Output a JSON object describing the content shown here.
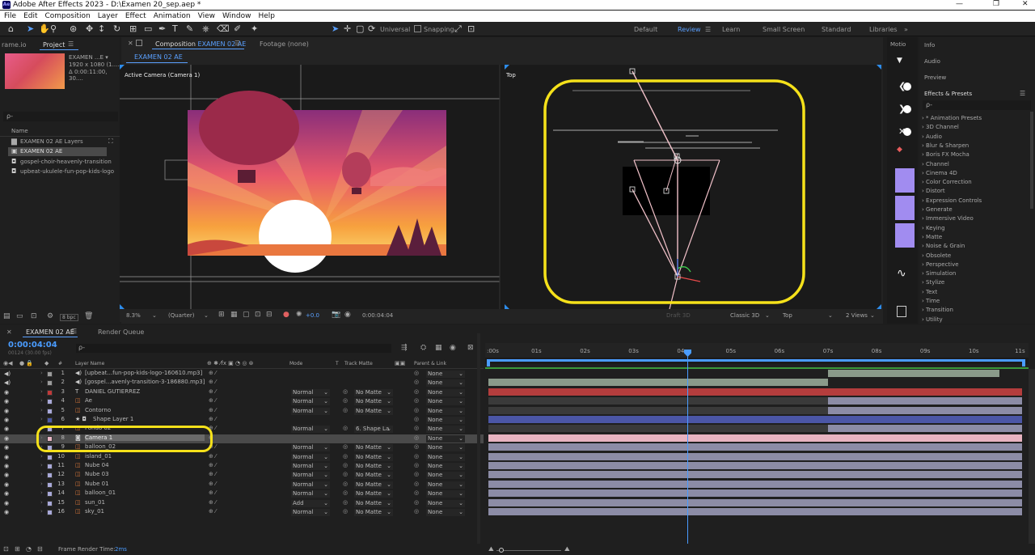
{
  "app": {
    "title": "Adobe After Effects 2023 - D:\\Examen 20_sep.aep *",
    "logo": "Ae"
  },
  "menu": [
    "File",
    "Edit",
    "Composition",
    "Layer",
    "Effect",
    "Animation",
    "View",
    "Window",
    "Help"
  ],
  "toolbar": {
    "universal": "Universal",
    "snapping": "Snapping"
  },
  "workspaces": [
    {
      "label": "Default",
      "active": false
    },
    {
      "label": "Review",
      "active": true
    },
    {
      "label": "Learn",
      "active": false
    },
    {
      "label": "Small Screen",
      "active": false
    },
    {
      "label": "Standard",
      "active": false
    },
    {
      "label": "Libraries",
      "active": false
    }
  ],
  "project": {
    "tab_left": "rame.io",
    "tab": "Project",
    "item_name": "EXAMEN ...E ▾",
    "item_dims": "1920 x 1080 (1....",
    "item_dur": "Δ 0:00:11:00, 30....",
    "search_placeholder": "ρ-",
    "col_name": "Name",
    "items": [
      {
        "label": "EXAMEN 02 AE Layers",
        "icon": "folder-icon",
        "selected": false
      },
      {
        "label": "EXAMEN 02 AE",
        "icon": "composition-icon",
        "selected": true
      },
      {
        "label": "gospel-choir-heavenly-transition",
        "icon": "audio-file-icon",
        "selected": false
      },
      {
        "label": "upbeat-ukulele-fun-pop-kids-logo",
        "icon": "audio-file-icon",
        "selected": false
      }
    ],
    "bpc": "8 bpc"
  },
  "composition": {
    "tab_label": "Composition",
    "tab_name": "EXAMEN 02 AE",
    "footage": "Footage (none)",
    "subtab": "EXAMEN 02 AE",
    "left_view": "Active Camera (Camera 1)",
    "right_view": "Top",
    "zoom": "8.3%",
    "resolution": "(Quarter)",
    "exposure": "+0.0",
    "timecode": "0:00:04:04",
    "draft": "Draft 3D",
    "renderer": "Classic 3D",
    "view_select": "Top",
    "views": "2 Views"
  },
  "right_panel": {
    "tab_motion": "Motio",
    "info": "Info",
    "audio": "Audio",
    "preview": "Preview",
    "effects_title": "Effects & Presets",
    "effects_search": "ρ-",
    "effects": [
      "* Animation Presets",
      "3D Channel",
      "Audio",
      "Blur & Sharpen",
      "Boris FX Mocha",
      "Channel",
      "Cinema 4D",
      "Color Correction",
      "Distort",
      "Expression Controls",
      "Generate",
      "Immersive Video",
      "Keying",
      "Matte",
      "Noise & Grain",
      "Obsolete",
      "Perspective",
      "Simulation",
      "Stylize",
      "Text",
      "Time",
      "Transition",
      "Utility"
    ]
  },
  "timeline": {
    "tab": "EXAMEN 02 AE",
    "render_queue": "Render Queue",
    "timecode": "0:00:04:04",
    "frame_info": "00124 (30.00 fps)",
    "col_hash": "#",
    "col_layer": "Layer Name",
    "col_mode": "Mode",
    "col_t": "T",
    "col_track": "Track Matte",
    "col_parent": "Parent & Link",
    "ruler": [
      ":00s",
      "01s",
      "02s",
      "03s",
      "04s",
      "05s",
      "06s",
      "07s",
      "08s",
      "09s",
      "10s",
      "11s"
    ],
    "render_time_label": "Frame Render Time:",
    "render_time_value": "2ms",
    "layers": [
      {
        "num": "1",
        "name": "[upbeat...fun-pop-kids-logo-160610.mp3]",
        "type": "audio",
        "color": "#9c9c9c",
        "mode": "",
        "track": "",
        "parent": "None",
        "audio": true
      },
      {
        "num": "2",
        "name": "[gospel...avenly-transition-3-186880.mp3]",
        "type": "audio",
        "color": "#9c9c9c",
        "mode": "",
        "track": "",
        "parent": "None",
        "audio": true
      },
      {
        "num": "3",
        "name": "DANIEL GUTIERREZ",
        "type": "text",
        "color": "#c03a3a",
        "mode": "Normal",
        "track": "No Matte",
        "parent": "None"
      },
      {
        "num": "4",
        "name": "Ae",
        "type": "ai",
        "color": "#a9a9d9",
        "mode": "Normal",
        "track": "No Matte",
        "parent": "None"
      },
      {
        "num": "5",
        "name": "Contorno",
        "type": "ai",
        "color": "#a9a9d9",
        "mode": "Normal",
        "track": "No Matte",
        "parent": "None"
      },
      {
        "num": "6",
        "name": "Shape Layer 1",
        "type": "shape",
        "color": "#4c5aa8",
        "mode": "",
        "track": "",
        "parent": "None"
      },
      {
        "num": "7",
        "name": "Fondo 02",
        "type": "ai",
        "color": "#a9a9d9",
        "mode": "Normal",
        "track": "6. Shape La",
        "parent": "None"
      },
      {
        "num": "8",
        "name": "Camera 1",
        "type": "camera",
        "color": "#e8b6c4",
        "mode": "",
        "track": "",
        "parent": "None",
        "selected": true
      },
      {
        "num": "9",
        "name": "balloon_02",
        "type": "ai",
        "color": "#a9a9d9",
        "mode": "Normal",
        "track": "No Matte",
        "parent": "None"
      },
      {
        "num": "10",
        "name": "island_01",
        "type": "ai",
        "color": "#a9a9d9",
        "mode": "Normal",
        "track": "No Matte",
        "parent": "None"
      },
      {
        "num": "11",
        "name": "Nube 04",
        "type": "ai",
        "color": "#a9a9d9",
        "mode": "Normal",
        "track": "No Matte",
        "parent": "None"
      },
      {
        "num": "12",
        "name": "Nube 03",
        "type": "ai",
        "color": "#a9a9d9",
        "mode": "Normal",
        "track": "No Matte",
        "parent": "None"
      },
      {
        "num": "13",
        "name": "Nube 01",
        "type": "ai",
        "color": "#a9a9d9",
        "mode": "Normal",
        "track": "No Matte",
        "parent": "None"
      },
      {
        "num": "14",
        "name": "balloon_01",
        "type": "ai",
        "color": "#a9a9d9",
        "mode": "Normal",
        "track": "No Matte",
        "parent": "None"
      },
      {
        "num": "15",
        "name": "sun_01",
        "type": "ai",
        "color": "#a9a9d9",
        "mode": "Add",
        "track": "No Matte",
        "parent": "None"
      },
      {
        "num": "16",
        "name": "sky_01",
        "type": "ai",
        "color": "#a9a9d9",
        "mode": "Normal",
        "track": "No Matte",
        "parent": "None"
      }
    ]
  },
  "colors": {
    "accent": "#2d8ceb",
    "highlight": "#f5e11a",
    "camera_bar": "#e7b3c0",
    "shape_bar": "#4b56a6",
    "text_bar": "#b43d3d",
    "ai_bar": "#8c8ca6",
    "audio_bar": "#8a9a8a"
  }
}
